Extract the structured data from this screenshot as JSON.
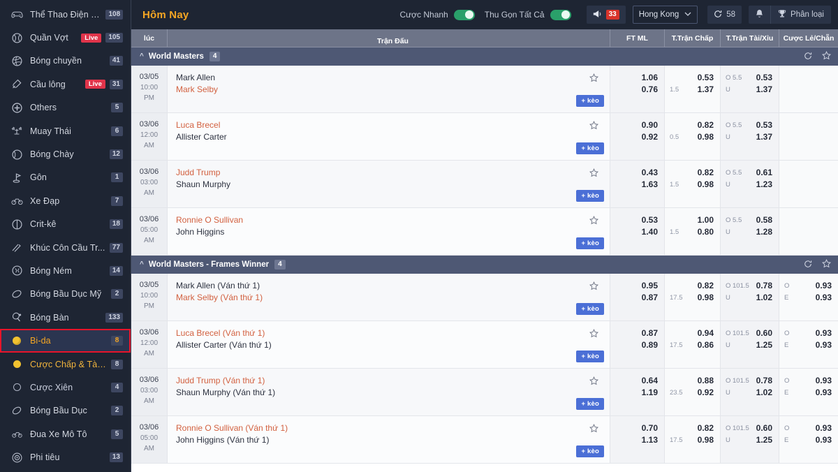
{
  "sidebar": {
    "items": [
      {
        "icon": "esports-icon",
        "label": "Thể Thao Điện Tử",
        "badge": "108",
        "live": "",
        "state": "normal"
      },
      {
        "icon": "tennis-icon",
        "label": "Quần Vợt",
        "badge": "105",
        "live": "Live",
        "state": "normal"
      },
      {
        "icon": "volleyball-icon",
        "label": "Bóng chuyền",
        "badge": "41",
        "live": "",
        "state": "normal"
      },
      {
        "icon": "badminton-icon",
        "label": "Cầu lông",
        "badge": "31",
        "live": "Live",
        "state": "normal"
      },
      {
        "icon": "others-icon",
        "label": "Others",
        "badge": "5",
        "live": "",
        "state": "normal"
      },
      {
        "icon": "muaythai-icon",
        "label": "Muay Thái",
        "badge": "6",
        "live": "",
        "state": "normal"
      },
      {
        "icon": "baseball-icon",
        "label": "Bóng Chày",
        "badge": "12",
        "live": "",
        "state": "normal"
      },
      {
        "icon": "golf-icon",
        "label": "Gôn",
        "badge": "1",
        "live": "",
        "state": "normal"
      },
      {
        "icon": "cycling-icon",
        "label": "Xe Đạp",
        "badge": "7",
        "live": "",
        "state": "normal"
      },
      {
        "icon": "cricket-icon",
        "label": "Crit-kê",
        "badge": "18",
        "live": "",
        "state": "normal"
      },
      {
        "icon": "hockey-icon",
        "label": "Khúc Côn Cầu Tr...",
        "badge": "77",
        "live": "",
        "state": "normal"
      },
      {
        "icon": "handball-icon",
        "label": "Bóng Ném",
        "badge": "14",
        "live": "",
        "state": "normal"
      },
      {
        "icon": "amfootball-icon",
        "label": "Bóng Bầu Dục Mỹ",
        "badge": "2",
        "live": "",
        "state": "normal"
      },
      {
        "icon": "tabletennis-icon",
        "label": "Bóng Bàn",
        "badge": "133",
        "live": "",
        "state": "normal"
      },
      {
        "icon": "billiards-icon",
        "label": "Bi-da",
        "badge": "8",
        "live": "",
        "state": "selected"
      },
      {
        "icon": "handicap-icon",
        "label": "Cược Chấp & Tài ...",
        "badge": "8",
        "live": "",
        "state": "sub"
      },
      {
        "icon": "parlay-icon",
        "label": "Cược Xiên",
        "badge": "4",
        "live": "",
        "state": "sub2"
      },
      {
        "icon": "rugby-icon",
        "label": "Bóng Bầu Dục",
        "badge": "2",
        "live": "",
        "state": "normal"
      },
      {
        "icon": "motorracing-icon",
        "label": "Đua Xe Mô Tô",
        "badge": "5",
        "live": "",
        "state": "normal"
      },
      {
        "icon": "darts-icon",
        "label": "Phi tiêu",
        "badge": "13",
        "live": "",
        "state": "normal"
      }
    ]
  },
  "topbar": {
    "title": "Hôm Nay",
    "quick_bet_label": "Cược Nhanh",
    "collapse_all_label": "Thu Gọn Tất Cả",
    "announce_count": "33",
    "region": "Hong Kong",
    "refresh_seconds": "58",
    "category_label": "Phân loại",
    "icons": {
      "megaphone": "megaphone-icon",
      "chevron": "chevron-down-icon",
      "refresh": "refresh-icon",
      "bell": "bell-icon",
      "trophy": "trophy-icon"
    }
  },
  "table": {
    "columns": {
      "time": "lúc",
      "match": "Trận Đấu",
      "ftml": "FT ML",
      "handicap": "T.Trận Chấp",
      "overunder": "T.Trận Tài/Xỉu",
      "oddeven": "Cược Lẻ/Chẵn"
    },
    "add_bet_label": "+ kèo"
  },
  "groups": [
    {
      "name": "World Masters",
      "count": "4",
      "matches": [
        {
          "date": "03/05",
          "time": "10:00",
          "ampm": "PM",
          "home": "Mark Allen",
          "away": "Mark Selby",
          "home_red": false,
          "away_red": true,
          "ftml": [
            "1.06",
            "0.76"
          ],
          "hdp_key": "1.5",
          "hdp": [
            "0.53",
            "1.37"
          ],
          "ou_keys": [
            "O 5.5",
            "U"
          ],
          "ou": [
            "0.53",
            "1.37"
          ],
          "oe_keys": [
            "",
            ""
          ],
          "oe": [
            "",
            ""
          ]
        },
        {
          "date": "03/06",
          "time": "12:00",
          "ampm": "AM",
          "home": "Luca Brecel",
          "away": "Allister Carter",
          "home_red": true,
          "away_red": false,
          "ftml": [
            "0.90",
            "0.92"
          ],
          "hdp_key": "0.5",
          "hdp": [
            "0.82",
            "0.98"
          ],
          "ou_keys": [
            "O 5.5",
            "U"
          ],
          "ou": [
            "0.53",
            "1.37"
          ],
          "oe_keys": [
            "",
            ""
          ],
          "oe": [
            "",
            ""
          ]
        },
        {
          "date": "03/06",
          "time": "03:00",
          "ampm": "AM",
          "home": "Judd Trump",
          "away": "Shaun Murphy",
          "home_red": true,
          "away_red": false,
          "ftml": [
            "0.43",
            "1.63"
          ],
          "hdp_key": "1.5",
          "hdp": [
            "0.82",
            "0.98"
          ],
          "ou_keys": [
            "O 5.5",
            "U"
          ],
          "ou": [
            "0.61",
            "1.23"
          ],
          "oe_keys": [
            "",
            ""
          ],
          "oe": [
            "",
            ""
          ]
        },
        {
          "date": "03/06",
          "time": "05:00",
          "ampm": "AM",
          "home": "Ronnie O Sullivan",
          "away": "John Higgins",
          "home_red": true,
          "away_red": false,
          "ftml": [
            "0.53",
            "1.40"
          ],
          "hdp_key": "1.5",
          "hdp": [
            "1.00",
            "0.80"
          ],
          "ou_keys": [
            "O 5.5",
            "U"
          ],
          "ou": [
            "0.58",
            "1.28"
          ],
          "oe_keys": [
            "",
            ""
          ],
          "oe": [
            "",
            ""
          ]
        }
      ]
    },
    {
      "name": "World Masters - Frames Winner",
      "count": "4",
      "matches": [
        {
          "date": "03/05",
          "time": "10:00",
          "ampm": "PM",
          "home": "Mark Allen (Ván thứ 1)",
          "away": "Mark Selby (Ván thứ 1)",
          "home_red": false,
          "away_red": true,
          "ftml": [
            "0.95",
            "0.87"
          ],
          "hdp_key": "17.5",
          "hdp": [
            "0.82",
            "0.98"
          ],
          "ou_keys": [
            "O 101.5",
            "U"
          ],
          "ou": [
            "0.78",
            "1.02"
          ],
          "oe_keys": [
            "O",
            "E"
          ],
          "oe": [
            "0.93",
            "0.93"
          ]
        },
        {
          "date": "03/06",
          "time": "12:00",
          "ampm": "AM",
          "home": "Luca Brecel (Ván thứ 1)",
          "away": "Allister Carter (Ván thứ 1)",
          "home_red": true,
          "away_red": false,
          "ftml": [
            "0.87",
            "0.89"
          ],
          "hdp_key": "17.5",
          "hdp": [
            "0.94",
            "0.86"
          ],
          "ou_keys": [
            "O 101.5",
            "U"
          ],
          "ou": [
            "0.60",
            "1.25"
          ],
          "oe_keys": [
            "O",
            "E"
          ],
          "oe": [
            "0.93",
            "0.93"
          ]
        },
        {
          "date": "03/06",
          "time": "03:00",
          "ampm": "AM",
          "home": "Judd Trump (Ván thứ 1)",
          "away": "Shaun Murphy (Ván thứ 1)",
          "home_red": true,
          "away_red": false,
          "ftml": [
            "0.64",
            "1.19"
          ],
          "hdp_key": "23.5",
          "hdp": [
            "0.88",
            "0.92"
          ],
          "ou_keys": [
            "O 101.5",
            "U"
          ],
          "ou": [
            "0.78",
            "1.02"
          ],
          "oe_keys": [
            "O",
            "E"
          ],
          "oe": [
            "0.93",
            "0.93"
          ]
        },
        {
          "date": "03/06",
          "time": "05:00",
          "ampm": "AM",
          "home": "Ronnie O Sullivan (Ván thứ 1)",
          "away": "John Higgins (Ván thứ 1)",
          "home_red": true,
          "away_red": false,
          "ftml": [
            "0.70",
            "1.13"
          ],
          "hdp_key": "17.5",
          "hdp": [
            "0.82",
            "0.98"
          ],
          "ou_keys": [
            "O 101.5",
            "U"
          ],
          "ou": [
            "0.60",
            "1.25"
          ],
          "oe_keys": [
            "O",
            "E"
          ],
          "oe": [
            "0.93",
            "0.93"
          ]
        }
      ]
    }
  ],
  "colors": {
    "sidebar_bg": "#1e2533",
    "accent_yellow": "#f5a623",
    "away_red": "#d2603f",
    "group_header": "#4e5874",
    "column_header": "#6d7488",
    "add_bet_blue": "#4b6fd6",
    "live_red": "#e0344a",
    "toggle_green": "#2aa06a",
    "highlight_box": "#e8142a"
  }
}
